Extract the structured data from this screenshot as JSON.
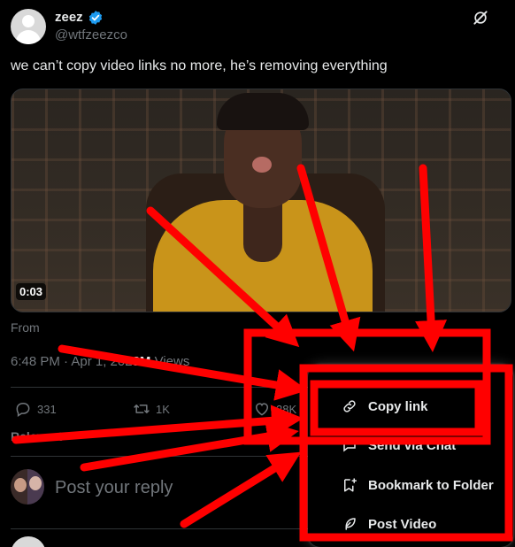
{
  "author": {
    "display_name": "zeez",
    "handle": "@wtfzeezco"
  },
  "tweet": {
    "text": "we can’t copy video links no more, he’s removing everything",
    "video_time": "0:03",
    "from_label": "From",
    "time_date": "6:48 PM · Apr 1, 202",
    "views_count": "3M",
    "views_label": "Views"
  },
  "actions": {
    "replies": "331",
    "reposts": "1K",
    "likes": "28K"
  },
  "sort_label": "Relevant",
  "reply": {
    "placeholder": "Post your reply"
  },
  "menu": {
    "items": [
      {
        "label": "Copy link",
        "icon": "link-icon"
      },
      {
        "label": "Send via Chat",
        "icon": "chat-icon"
      },
      {
        "label": "Bookmark to Folder",
        "icon": "bookmark-plus-icon"
      },
      {
        "label": "Post Video",
        "icon": "feather-icon"
      }
    ]
  },
  "colors": {
    "background": "#000000",
    "text": "#e7e9ea",
    "muted": "#71767b",
    "verified": "#1d9bf0",
    "annotation": "#ff0000"
  }
}
